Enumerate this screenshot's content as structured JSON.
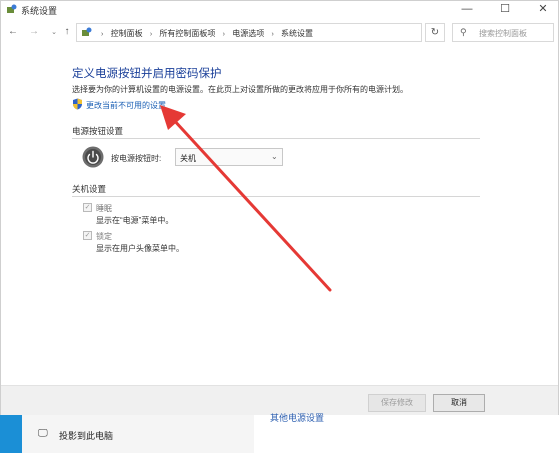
{
  "window": {
    "title": "系统设置",
    "controls": {
      "minimize": "—",
      "maximize": "☐",
      "close": "✕"
    }
  },
  "nav": {
    "back": "←",
    "forward": "→",
    "recent": "⌄",
    "up": "↑",
    "breadcrumbs": [
      "控制面板",
      "所有控制面板项",
      "电源选项",
      "系统设置"
    ],
    "dropdown": "⌄",
    "refresh": "↻",
    "search_placeholder": "搜索控制面板",
    "search_icon": "⚲"
  },
  "content": {
    "heading": "定义电源按钮并启用密码保护",
    "description": "选择要为你的计算机设置的电源设置。在此页上对设置所做的更改将应用于你所有的电源计划。",
    "change_link": "更改当前不可用的设置",
    "power_section": {
      "title": "电源按钮设置",
      "label": "按电源按钮时:",
      "selected": "关机",
      "chevron": "⌄"
    },
    "shutdown_section": {
      "title": "关机设置",
      "items": [
        {
          "label": "睡眠",
          "desc": "显示在“电源”菜单中。",
          "checked": true
        },
        {
          "label": "锁定",
          "desc": "显示在用户头像菜单中。",
          "checked": true
        }
      ],
      "check_glyph": "✓"
    }
  },
  "footer": {
    "save": "保存修改",
    "cancel": "取消"
  },
  "background": {
    "project_label": "投影到此电脑",
    "project_icon": "🖵",
    "link_text": "其他电源设置"
  },
  "colors": {
    "heading": "#1a3f99",
    "link": "#1a5fb4",
    "annotation_arrow": "#e53935",
    "taskbar": "#1b8fd6"
  }
}
